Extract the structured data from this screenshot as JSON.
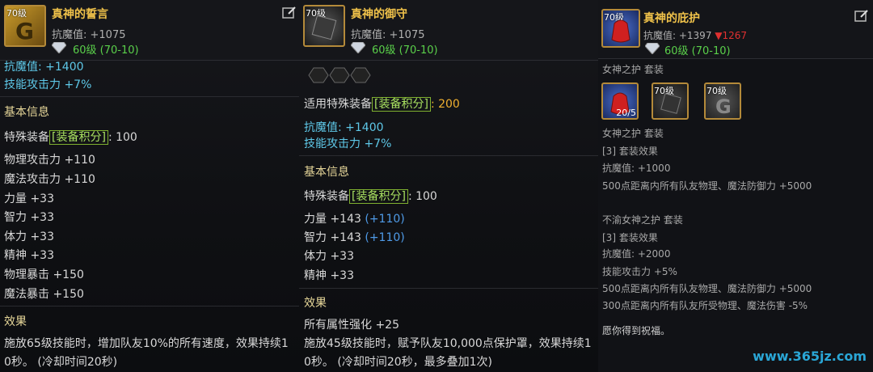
{
  "panels": [
    {
      "level_badge": "70级",
      "title": "真神的誓言",
      "magic_resist": "抗魔值: +1075",
      "level_range": "60级 (70-10)",
      "lines": {
        "cutoff": "抗魔值: +1400",
        "skill_atk": "技能攻击力 +7%",
        "basic_info": "基本信息",
        "special_label": "特殊装备",
        "special_tag": "[装备积分]",
        "special_value": ": 100",
        "phys_atk": "物理攻击力 +110",
        "mag_atk": "魔法攻击力 +110",
        "str": "力量 +33",
        "int": "智力 +33",
        "vit": "体力 +33",
        "spr": "精神 +33",
        "phys_crit": "物理暴击 +150",
        "mag_crit": "魔法暴击 +150",
        "effect_title": "效果",
        "effect_1": "施放65级技能时，增加队友10%的所有速度，效果持续1",
        "effect_2": "0秒。 (冷却时间20秒)"
      }
    },
    {
      "level_badge": "70级",
      "title": "真神的御守",
      "magic_resist": "抗魔值: +1075",
      "level_range": "60级 (70-10)",
      "lines": {
        "applicable_label": "适用特殊装备",
        "applicable_tag": "[装备积分]",
        "applicable_value": ": 200",
        "mres": "抗魔值: +1400",
        "skill_atk": "技能攻击力 +7%",
        "basic_info": "基本信息",
        "special_label": "特殊装备",
        "special_tag": "[装备积分]",
        "special_value": ": 100",
        "str": "力量 +143",
        "str_bonus": "(+110)",
        "int": "智力 +143",
        "int_bonus": "(+110)",
        "vit": "体力 +33",
        "spr": "精神 +33",
        "effect_title": "效果",
        "all_attr": "所有属性强化 +25",
        "effect_1": "施放45级技能时，赋予队友10,000点保护罩，效果持续1",
        "effect_2": "0秒。 (冷却时间20秒，最多叠加1次)"
      }
    },
    {
      "level_badge": "70级",
      "title": "真神的庇护",
      "magic_resist": "抗魔值: +1397",
      "resist_change": "▼1267",
      "level_range": "60级 (70-10)",
      "cutoff": "女神之护 套装",
      "slots": [
        {
          "level": "",
          "count": "20/5"
        },
        {
          "level": "70级"
        },
        {
          "level": "70级"
        }
      ],
      "lines": {
        "set1_name": "女神之护 套装",
        "set1_effect": "[3] 套装效果",
        "set1_mres": "抗魔值: +1000",
        "set1_party": "500点距离内所有队友物理、魔法防御力 +5000",
        "set2_name": "不渝女神之护 套装",
        "set2_effect": "[3] 套装效果",
        "set2_mres": "抗魔值: +2000",
        "set2_skill": "技能攻击力 +5%",
        "set2_party": "500点距离内所有队友物理、魔法防御力 +5000",
        "set2_dmg": "300点距离内所有队友所受物理、魔法伤害 -5%",
        "blessing": "愿你得到祝福。"
      }
    }
  ],
  "watermark": "www.365jz.com"
}
